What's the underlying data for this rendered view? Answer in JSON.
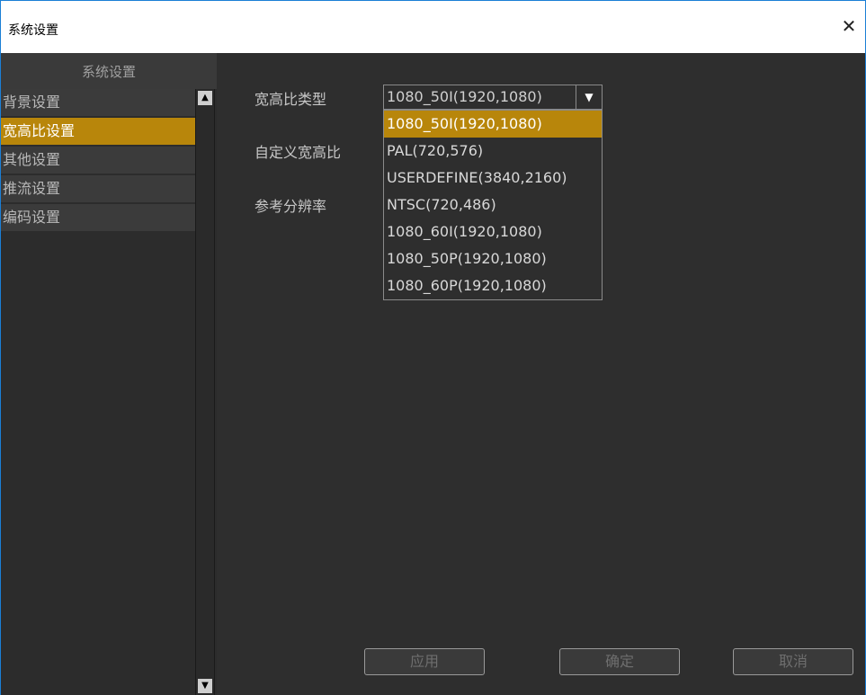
{
  "window": {
    "title": "系统设置",
    "close_icon": "close-icon"
  },
  "sidebar": {
    "title": "系统设置",
    "items": [
      {
        "label": "背景设置"
      },
      {
        "label": "宽高比设置",
        "active": true
      },
      {
        "label": "其他设置"
      },
      {
        "label": "推流设置"
      },
      {
        "label": "编码设置"
      }
    ]
  },
  "form": {
    "aspect_type_label": "宽高比类型",
    "custom_aspect_label": "自定义宽高比",
    "reference_resolution_label": "参考分辨率",
    "aspect_type_value": "1080_50I(1920,1080)",
    "options": [
      "1080_50I(1920,1080)",
      "PAL(720,576)",
      "USERDEFINE(3840,2160)",
      "NTSC(720,486)",
      "1080_60I(1920,1080)",
      "1080_50P(1920,1080)",
      "1080_60P(1920,1080)"
    ]
  },
  "buttons": {
    "apply": "应用",
    "ok": "确定",
    "cancel": "取消"
  },
  "colors": {
    "accent": "#b8860b",
    "panel": "#2e2e2e"
  }
}
